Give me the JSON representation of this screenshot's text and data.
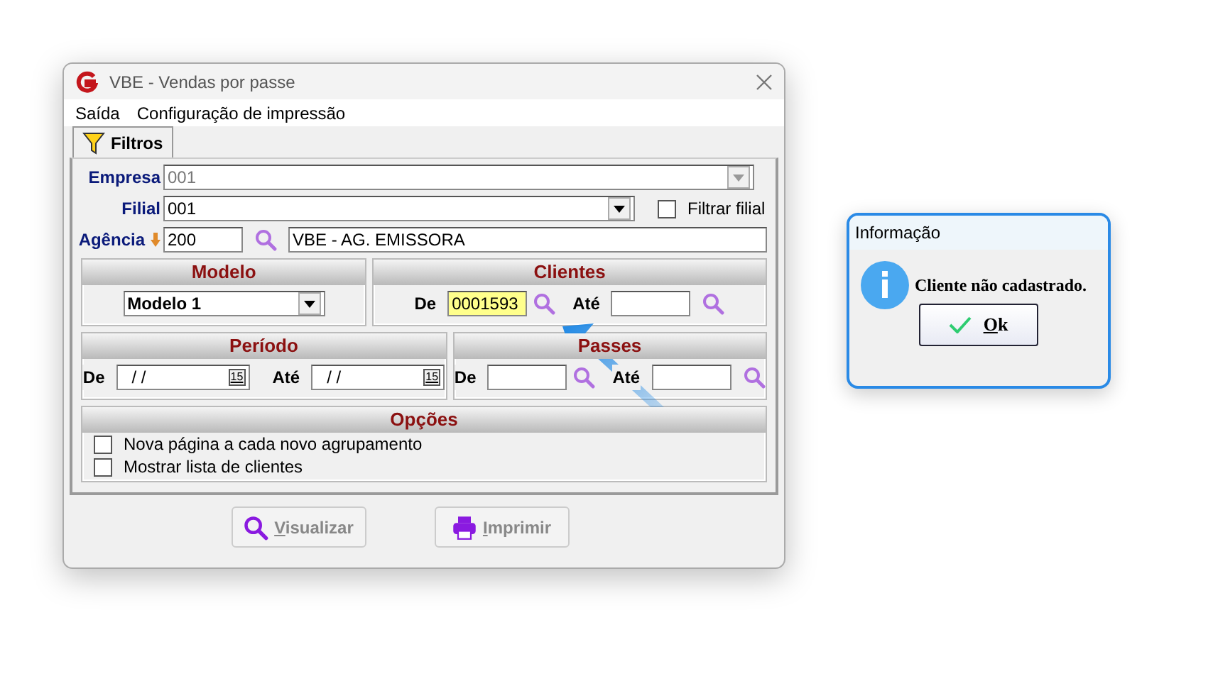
{
  "window": {
    "title": "VBE - Vendas por passe"
  },
  "menu": [
    {
      "label": "Saída"
    },
    {
      "label": "Configuração de impressão"
    }
  ],
  "tabs": [
    {
      "label": "Filtros",
      "selected": true
    }
  ],
  "empresa": {
    "label": "Empresa",
    "value": "001",
    "disabled": true
  },
  "filial": {
    "label": "Filial",
    "value": "001",
    "disabled": false
  },
  "filtrar_filial": {
    "label": "Filtrar filial",
    "checked": false
  },
  "agencia": {
    "label": "Agência",
    "value": "200",
    "description": "VBE - AG. EMISSORA"
  },
  "modelo": {
    "title": "Modelo",
    "value": "Modelo 1"
  },
  "clientes": {
    "title": "Clientes",
    "from_label": "De",
    "from_value": "0001593",
    "from_highlighted": true,
    "to_label": "Até"
  },
  "periodo": {
    "title": "Período",
    "from_label": "De",
    "from_value": "/ /",
    "from_calendar": "15",
    "to_label": "Até",
    "to_value": "/ /",
    "to_calendar": "15"
  },
  "passes": {
    "title": "Passes",
    "from_label": "De",
    "to_label": "Até"
  },
  "opcoes": {
    "title": "Opções",
    "options": [
      {
        "label": "Nova página a cada novo agrupamento",
        "checked": false
      },
      {
        "label": "Mostrar lista de clientes",
        "checked": false
      }
    ]
  },
  "buttons": [
    {
      "label": "Visualizar",
      "kind": "search",
      "disabled": true
    },
    {
      "label": "Imprimir",
      "kind": "printer",
      "disabled": true
    }
  ],
  "dialog": {
    "title": "Informação",
    "message": "Cliente não cadastrado.",
    "button": "Ok"
  }
}
